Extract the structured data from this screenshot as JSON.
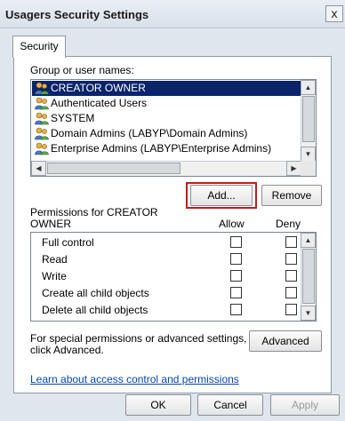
{
  "window": {
    "title": "Usagers Security Settings",
    "close_label": "x"
  },
  "tabs": [
    {
      "label": "Security"
    }
  ],
  "group_section": {
    "label": "Group or user names:",
    "users": [
      {
        "name": "CREATOR OWNER",
        "selected": true
      },
      {
        "name": "Authenticated Users",
        "selected": false
      },
      {
        "name": "SYSTEM",
        "selected": false
      },
      {
        "name": "Domain Admins (LABYP\\Domain Admins)",
        "selected": false
      },
      {
        "name": "Enterprise Admins (LABYP\\Enterprise Admins)",
        "selected": false
      }
    ],
    "add_label": "Add...",
    "remove_label": "Remove"
  },
  "permissions": {
    "label_line1": "Permissions for CREATOR",
    "label_line2": "OWNER",
    "allow_header": "Allow",
    "deny_header": "Deny",
    "rows": [
      {
        "name": "Full control",
        "allow": false,
        "deny": false
      },
      {
        "name": "Read",
        "allow": false,
        "deny": false
      },
      {
        "name": "Write",
        "allow": false,
        "deny": false
      },
      {
        "name": "Create all child objects",
        "allow": false,
        "deny": false
      },
      {
        "name": "Delete all child objects",
        "allow": false,
        "deny": false
      }
    ]
  },
  "special": {
    "text_line1": "For special permissions or advanced settings,",
    "text_line2": "click Advanced.",
    "advanced_label": "Advanced"
  },
  "link_text": "Learn about access control and permissions",
  "footer": {
    "ok_label": "OK",
    "cancel_label": "Cancel",
    "apply_label": "Apply"
  },
  "colors": {
    "selection": "#0a246a",
    "highlight_box": "#c21b1b",
    "link": "#0645ad"
  }
}
